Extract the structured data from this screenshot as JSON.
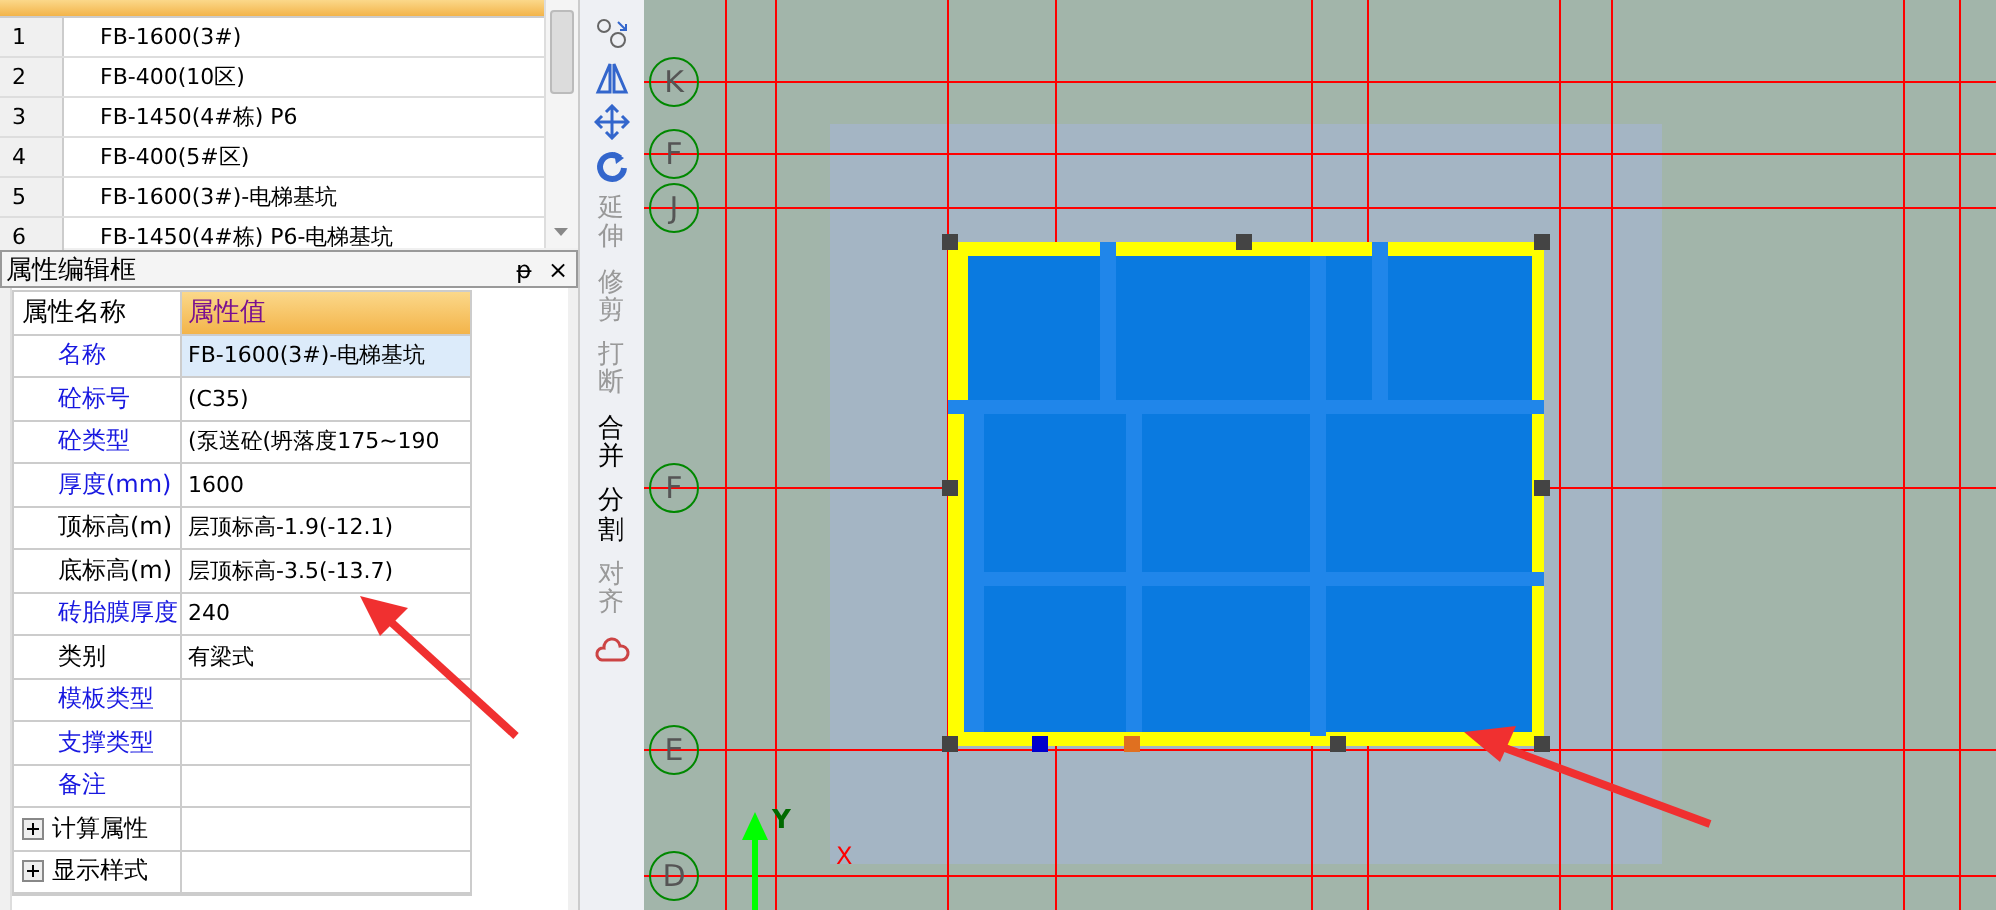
{
  "component_list": {
    "rows": [
      {
        "index": "1",
        "name": "FB-1600(3#)"
      },
      {
        "index": "2",
        "name": "FB-400(10区)"
      },
      {
        "index": "3",
        "name": "FB-1450(4#栋) P6"
      },
      {
        "index": "4",
        "name": "FB-400(5#区)"
      },
      {
        "index": "5",
        "name": "FB-1600(3#)-电梯基坑"
      },
      {
        "index": "6",
        "name": "FB-1450(4#栋) P6-电梯基坑"
      }
    ]
  },
  "property_panel": {
    "title": "属性编辑框",
    "pin": "ᵽ",
    "close": "×",
    "columns": [
      "属性名称",
      "属性值"
    ],
    "rows": [
      {
        "name": "名称",
        "value": "FB-1600(3#)-电梯基坑",
        "kind": "public",
        "selected": true
      },
      {
        "name": "砼标号",
        "value": "(C35)",
        "kind": "public",
        "selected": false
      },
      {
        "name": "砼类型",
        "value": "(泵送砼(坍落度175~190",
        "kind": "public",
        "selected": false
      },
      {
        "name": "厚度(mm)",
        "value": "1600",
        "kind": "public",
        "selected": false
      },
      {
        "name": "顶标高(m)",
        "value": "层顶标高-1.9(-12.1)",
        "kind": "private",
        "selected": false
      },
      {
        "name": "底标高(m)",
        "value": "层顶标高-3.5(-13.7)",
        "kind": "private",
        "selected": false
      },
      {
        "name": "砖胎膜厚度",
        "value": "240",
        "kind": "public",
        "selected": false
      },
      {
        "name": "类别",
        "value": "有梁式",
        "kind": "private",
        "selected": false
      },
      {
        "name": "模板类型",
        "value": "",
        "kind": "public",
        "selected": false
      },
      {
        "name": "支撑类型",
        "value": "",
        "kind": "public",
        "selected": false
      },
      {
        "name": "备注",
        "value": "",
        "kind": "public",
        "selected": false
      },
      {
        "name": "计算属性",
        "value": "",
        "kind": "group",
        "selected": false
      },
      {
        "name": "显示样式",
        "value": "",
        "kind": "group",
        "selected": false
      }
    ]
  },
  "toolbar": [
    {
      "kind": "icon"
    },
    {
      "kind": "icon"
    },
    {
      "kind": "icon"
    },
    {
      "kind": "icon"
    },
    {
      "kind": "text",
      "label": "延伸",
      "disabled": true
    },
    {
      "kind": "text",
      "label": "修剪",
      "disabled": true
    },
    {
      "kind": "text",
      "label": "打断",
      "disabled": true
    },
    {
      "kind": "text",
      "label": "合并",
      "disabled": false
    },
    {
      "kind": "text",
      "label": "分割",
      "disabled": false
    },
    {
      "kind": "text",
      "label": "对齐",
      "disabled": true
    },
    {
      "kind": "icon"
    }
  ],
  "canvas": {
    "axis_labels": [
      "K",
      "F",
      "J",
      "F",
      "E",
      "D"
    ],
    "axis_x": "X",
    "axis_y": "Y"
  }
}
